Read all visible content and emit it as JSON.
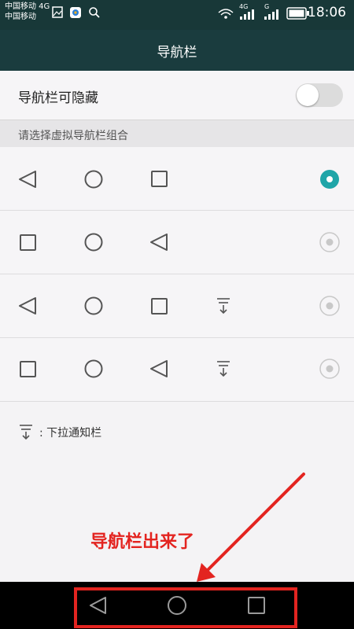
{
  "status_bar": {
    "carrier_line1": "中国移动 4G",
    "carrier_line2": "中国移动",
    "network_4g": "4G",
    "network_g": "G",
    "time": "18:06",
    "icons": [
      "image-icon",
      "app-icon",
      "search-icon",
      "wifi-icon",
      "signal-icon",
      "signal-icon",
      "battery-icon"
    ]
  },
  "header": {
    "title": "导航栏"
  },
  "toggle_row": {
    "label": "导航栏可隐藏",
    "enabled": false
  },
  "section": {
    "header": "请选择虚拟导航栏组合"
  },
  "combinations": [
    {
      "buttons": [
        "back-icon",
        "home-icon",
        "recent-icon"
      ],
      "selected": true
    },
    {
      "buttons": [
        "recent-icon",
        "home-icon",
        "back-icon"
      ],
      "selected": false
    },
    {
      "buttons": [
        "back-icon",
        "home-icon",
        "recent-icon",
        "notification-pulldown-icon"
      ],
      "selected": false
    },
    {
      "buttons": [
        "recent-icon",
        "home-icon",
        "back-icon",
        "notification-pulldown-icon"
      ],
      "selected": false
    }
  ],
  "legend": {
    "text": ": 下拉通知栏",
    "icon": "notification-pulldown-icon"
  },
  "annotation": {
    "text": "导航栏出来了",
    "color": "#e32420"
  },
  "nav_bar": {
    "buttons": [
      "back-icon",
      "home-icon",
      "recent-icon"
    ]
  },
  "colors": {
    "accent": "#1fa5a8",
    "header_bg": "#1a3c3e",
    "annotation": "#e32420"
  }
}
